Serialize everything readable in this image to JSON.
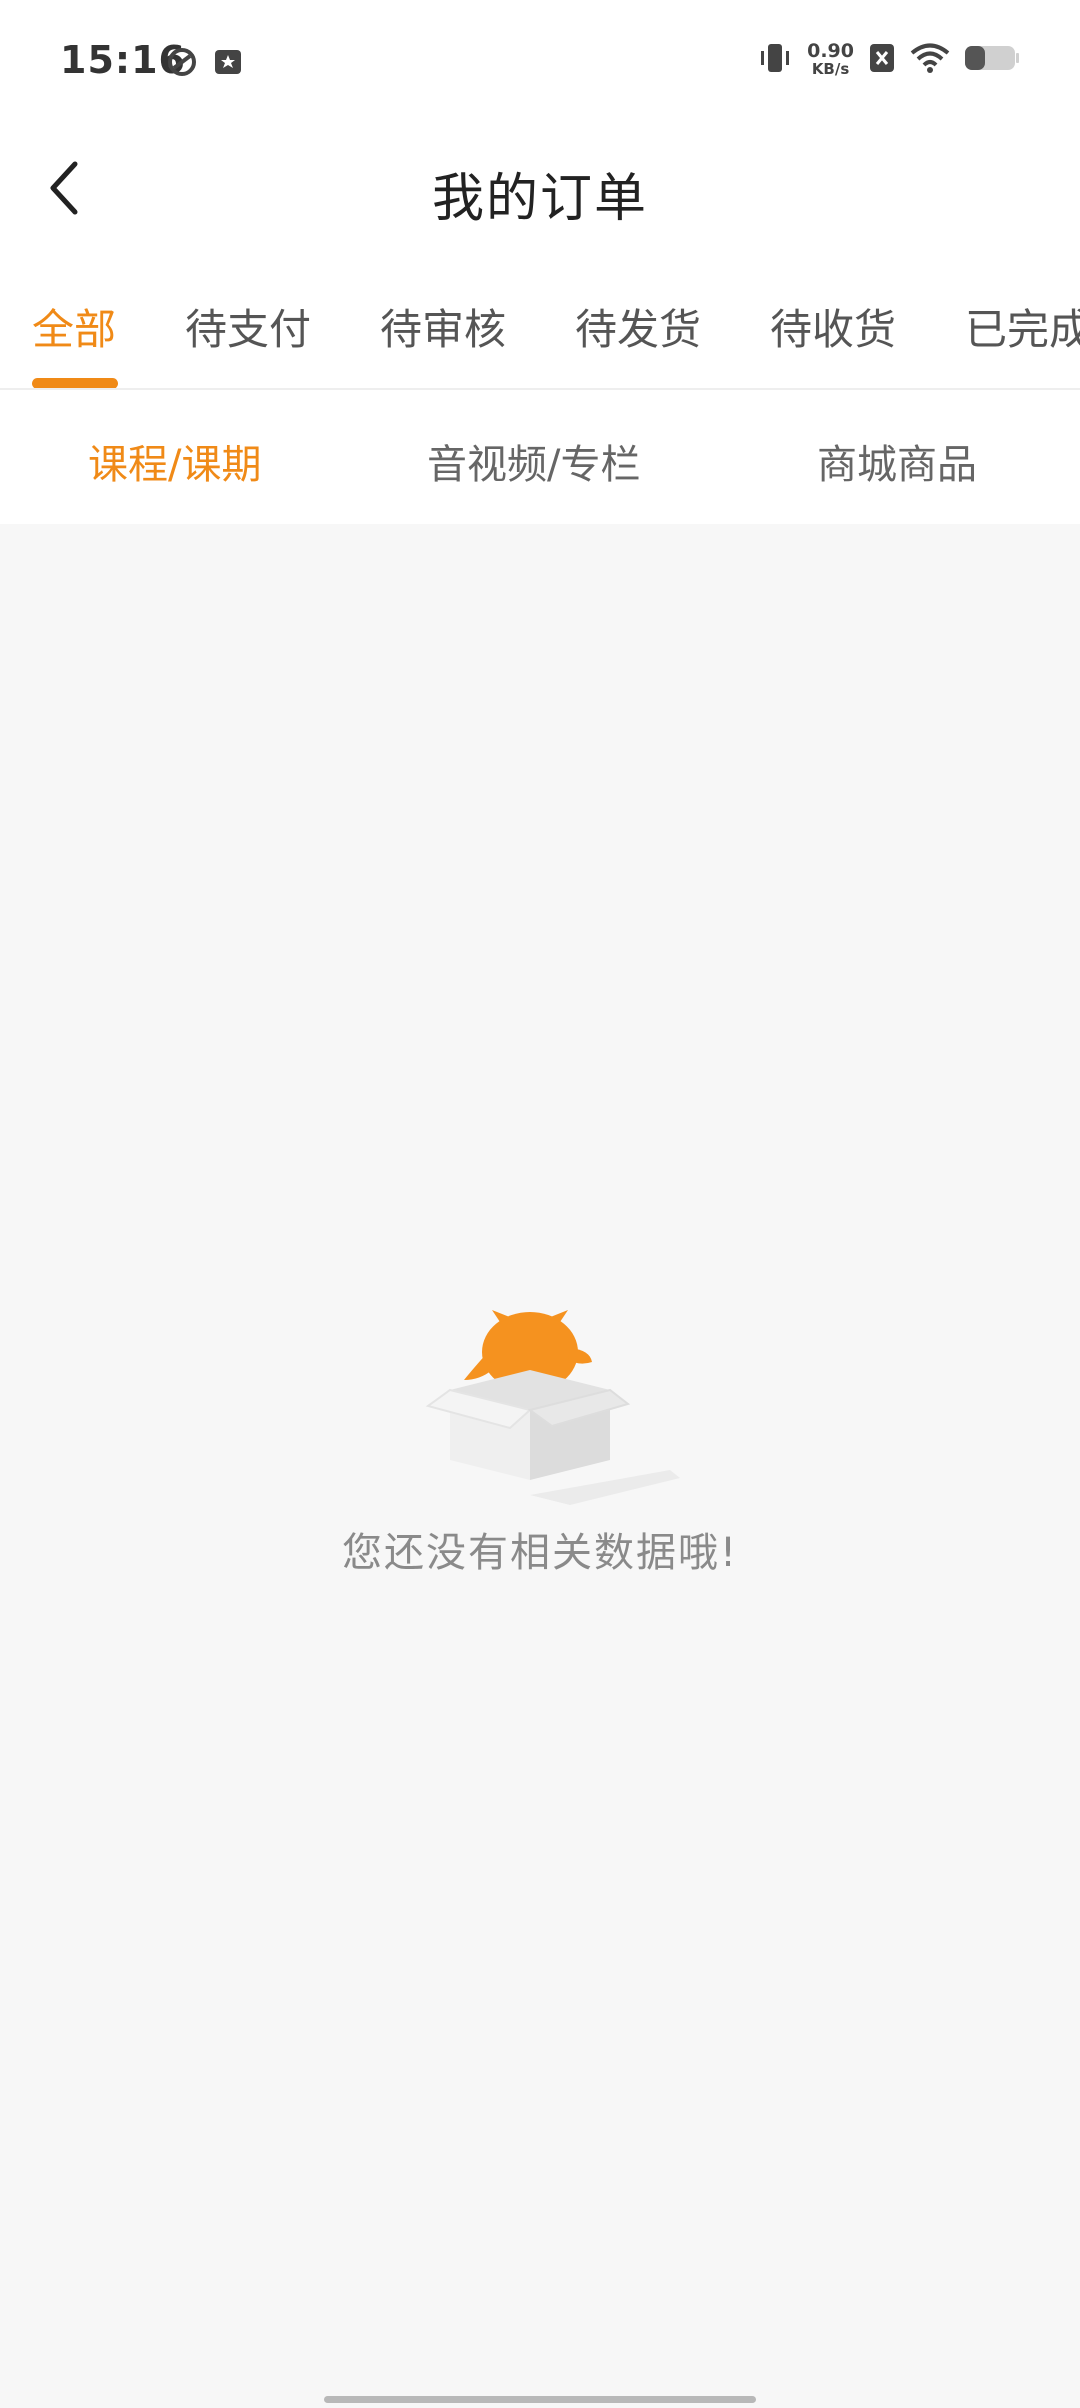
{
  "status_bar": {
    "time": "15:16",
    "net_speed_value": "0.90",
    "net_speed_unit": "KB/s",
    "icons": [
      "sync-icon",
      "notification-icon",
      "vibrate-icon",
      "sim-x-icon",
      "wifi-icon",
      "battery-icon"
    ]
  },
  "header": {
    "title": "我的订单",
    "back_icon": "chevron-left-icon"
  },
  "tabs": [
    {
      "label": "全部",
      "active": true
    },
    {
      "label": "待支付",
      "active": false
    },
    {
      "label": "待审核",
      "active": false
    },
    {
      "label": "待发货",
      "active": false
    },
    {
      "label": "待收货",
      "active": false
    },
    {
      "label": "已完成",
      "active": false
    }
  ],
  "subtabs": [
    {
      "label": "课程/课期",
      "active": true
    },
    {
      "label": "音视频/专栏",
      "active": false
    },
    {
      "label": "商城商品",
      "active": false
    }
  ],
  "empty_state": {
    "message": "您还没有相关数据哦!",
    "icon": "empty-box-icon"
  },
  "colors": {
    "accent": "#f08a17",
    "background": "#f7f7f7",
    "text_primary": "#222222",
    "text_secondary": "#555555"
  }
}
